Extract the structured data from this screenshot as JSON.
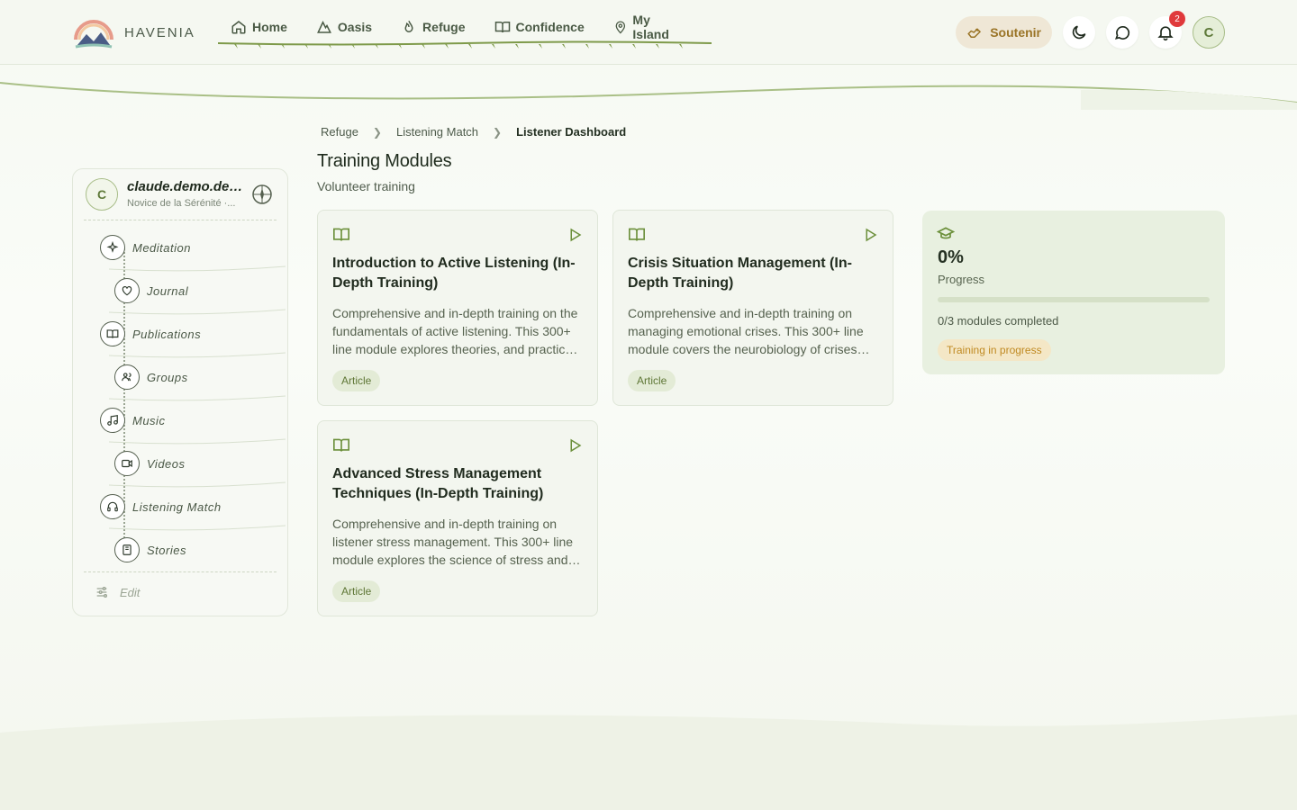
{
  "app": {
    "logo_text": "HAVENIA"
  },
  "nav": {
    "items": [
      {
        "label": "Home",
        "icon": "home-icon"
      },
      {
        "label": "Oasis",
        "icon": "mountain-icon"
      },
      {
        "label": "Refuge",
        "icon": "flame-icon"
      },
      {
        "label": "Confidence",
        "icon": "book-icon"
      },
      {
        "label": "My Island",
        "icon": "map-pin-icon"
      }
    ]
  },
  "header": {
    "support_label": "Soutenir",
    "notification_count": "2",
    "avatar_initial": "C"
  },
  "sidebar": {
    "profile": {
      "initial": "C",
      "name": "claude.demo.des...",
      "subtitle": "Novice de la Sérénité ·..."
    },
    "items": [
      {
        "label": "Meditation",
        "icon": "sparkle-icon"
      },
      {
        "label": "Journal",
        "icon": "heart-icon"
      },
      {
        "label": "Publications",
        "icon": "book-open-icon"
      },
      {
        "label": "Groups",
        "icon": "users-icon"
      },
      {
        "label": "Music",
        "icon": "music-icon"
      },
      {
        "label": "Videos",
        "icon": "video-icon"
      },
      {
        "label": "Listening Match",
        "icon": "headphones-icon"
      },
      {
        "label": "Stories",
        "icon": "notebook-icon"
      }
    ],
    "edit_label": "Edit"
  },
  "breadcrumb": [
    "Refuge",
    "Listening Match",
    "Listener Dashboard"
  ],
  "page": {
    "title": "Training Modules",
    "subtitle": "Volunteer training"
  },
  "modules": [
    {
      "title": "Introduction to Active Listening (In-Depth Training)",
      "description": "Comprehensive and in-depth training on the fundamentals of active listening. This 300+ line module explores theories, and practical techniques for listeners.",
      "tag": "Article"
    },
    {
      "title": "Crisis Situation Management (In-Depth Training)",
      "description": "Comprehensive and in-depth training on managing emotional crises. This 300+ line module covers the neurobiology of crises and intervention protocols.",
      "tag": "Article"
    },
    {
      "title": "Advanced Stress Management Techniques (In-Depth Training)",
      "description": "Comprehensive and in-depth training on listener stress management. This 300+ line module explores the science of stress and recovery strategies.",
      "tag": "Article"
    }
  ],
  "progress": {
    "value_label": "0%",
    "fraction": 0,
    "label": "Progress",
    "count": "0/3 modules completed",
    "status": "Training in progress"
  },
  "colors": {
    "accent": "#6b8f3a",
    "status_warning": "#c08a22",
    "badge": "#e0393b"
  }
}
